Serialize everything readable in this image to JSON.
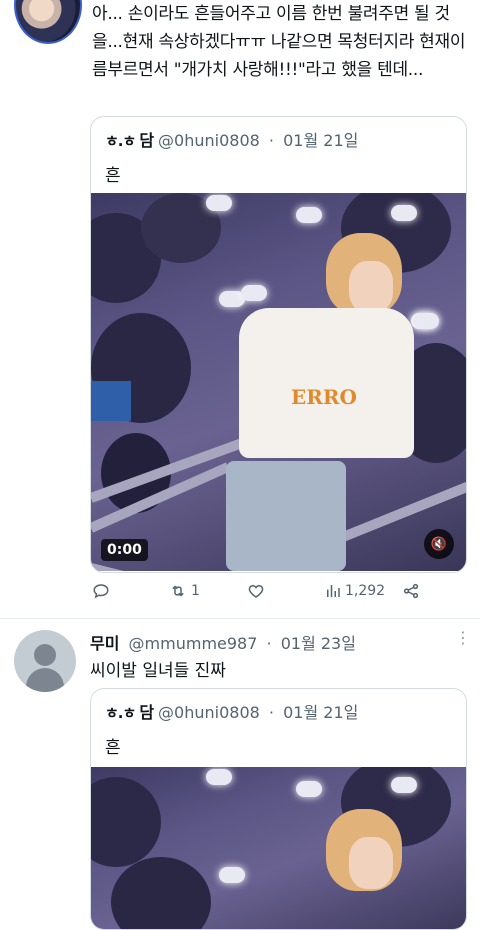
{
  "tweet1": {
    "text": "아... 손이라도 흔들어주고 이름 한번 불려주면 될 것을...현재 속상하겠다ㅠㅠ 나같으면 목청터지라 현재이름부르면서 \"개가치 사랑해!!!\"라고 했을 텐데...",
    "quote": {
      "face": "ㅎ.ㅎ",
      "name": "담",
      "handle": "@0huni0808",
      "dot": "·",
      "date": "01월 21일",
      "text": "흔",
      "shirt_print": "ERRO",
      "video_time": "0:00",
      "mute_icon": "🔇"
    },
    "actions": {
      "reply_icon": "reply-icon",
      "retweet_icon": "retweet-icon",
      "retweet_count": "1",
      "like_icon": "heart-icon",
      "views_icon": "bar-chart-icon",
      "views_count": "1,292",
      "share_icon": "share-icon"
    }
  },
  "tweet2": {
    "name": "무미",
    "handle": "@mmumme987",
    "dot": "·",
    "date": "01월 23일",
    "text": "씨이발 일녀들 진짜",
    "more_icon": "more-icon",
    "quote": {
      "face": "ㅎ.ㅎ",
      "name": "담",
      "handle": "@0huni0808",
      "dot": "·",
      "date": "01월 21일",
      "text": "흔"
    }
  },
  "colors": {
    "text_primary": "#0f1419",
    "text_secondary": "#536471",
    "border": "#d5dbe0"
  }
}
